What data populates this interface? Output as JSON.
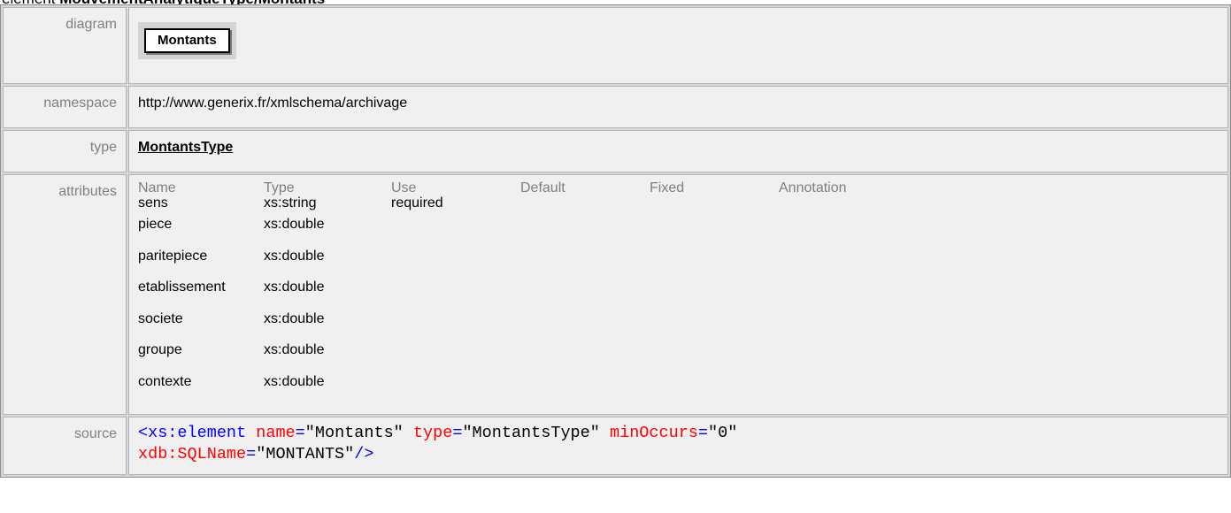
{
  "heading": {
    "prefix": "element ",
    "title": "MouvementAnalytiqueType/Montants"
  },
  "labels": {
    "diagram": "diagram",
    "namespace": "namespace",
    "type": "type",
    "attributes": "attributes",
    "source": "source"
  },
  "diagram": {
    "element_name": "Montants"
  },
  "namespace": "http://www.generix.fr/xmlschema/archivage",
  "type": "MontantsType",
  "attributes": {
    "headers": [
      "Name",
      "Type",
      "Use",
      "Default",
      "Fixed",
      "Annotation"
    ],
    "rows": [
      {
        "name": "sens",
        "type": "xs:string",
        "use": "required"
      },
      {
        "name": "piece",
        "type": "xs:double",
        "use": ""
      },
      {
        "name": "paritepiece",
        "type": "xs:double",
        "use": ""
      },
      {
        "name": "etablissement",
        "type": "xs:double",
        "use": ""
      },
      {
        "name": "societe",
        "type": "xs:double",
        "use": ""
      },
      {
        "name": "groupe",
        "type": "xs:double",
        "use": ""
      },
      {
        "name": "contexte",
        "type": "xs:double",
        "use": ""
      }
    ]
  },
  "source": {
    "line1": {
      "open": "<xs:element",
      "a1_name": "name",
      "a1_val": "\"Montants\"",
      "a2_name": "type",
      "a2_val": "\"MontantsType\"",
      "a3_name": "minOccurs",
      "a3_val": "\"0\""
    },
    "line2": {
      "a4_name": "xdb:SQLName",
      "a4_val": "\"MONTANTS\"",
      "close": "/>"
    }
  },
  "colors": {
    "label_text": "#808080",
    "cell_bg": "#f0f0f0",
    "tag": "#0000ff",
    "attr_name": "#ff0000"
  }
}
